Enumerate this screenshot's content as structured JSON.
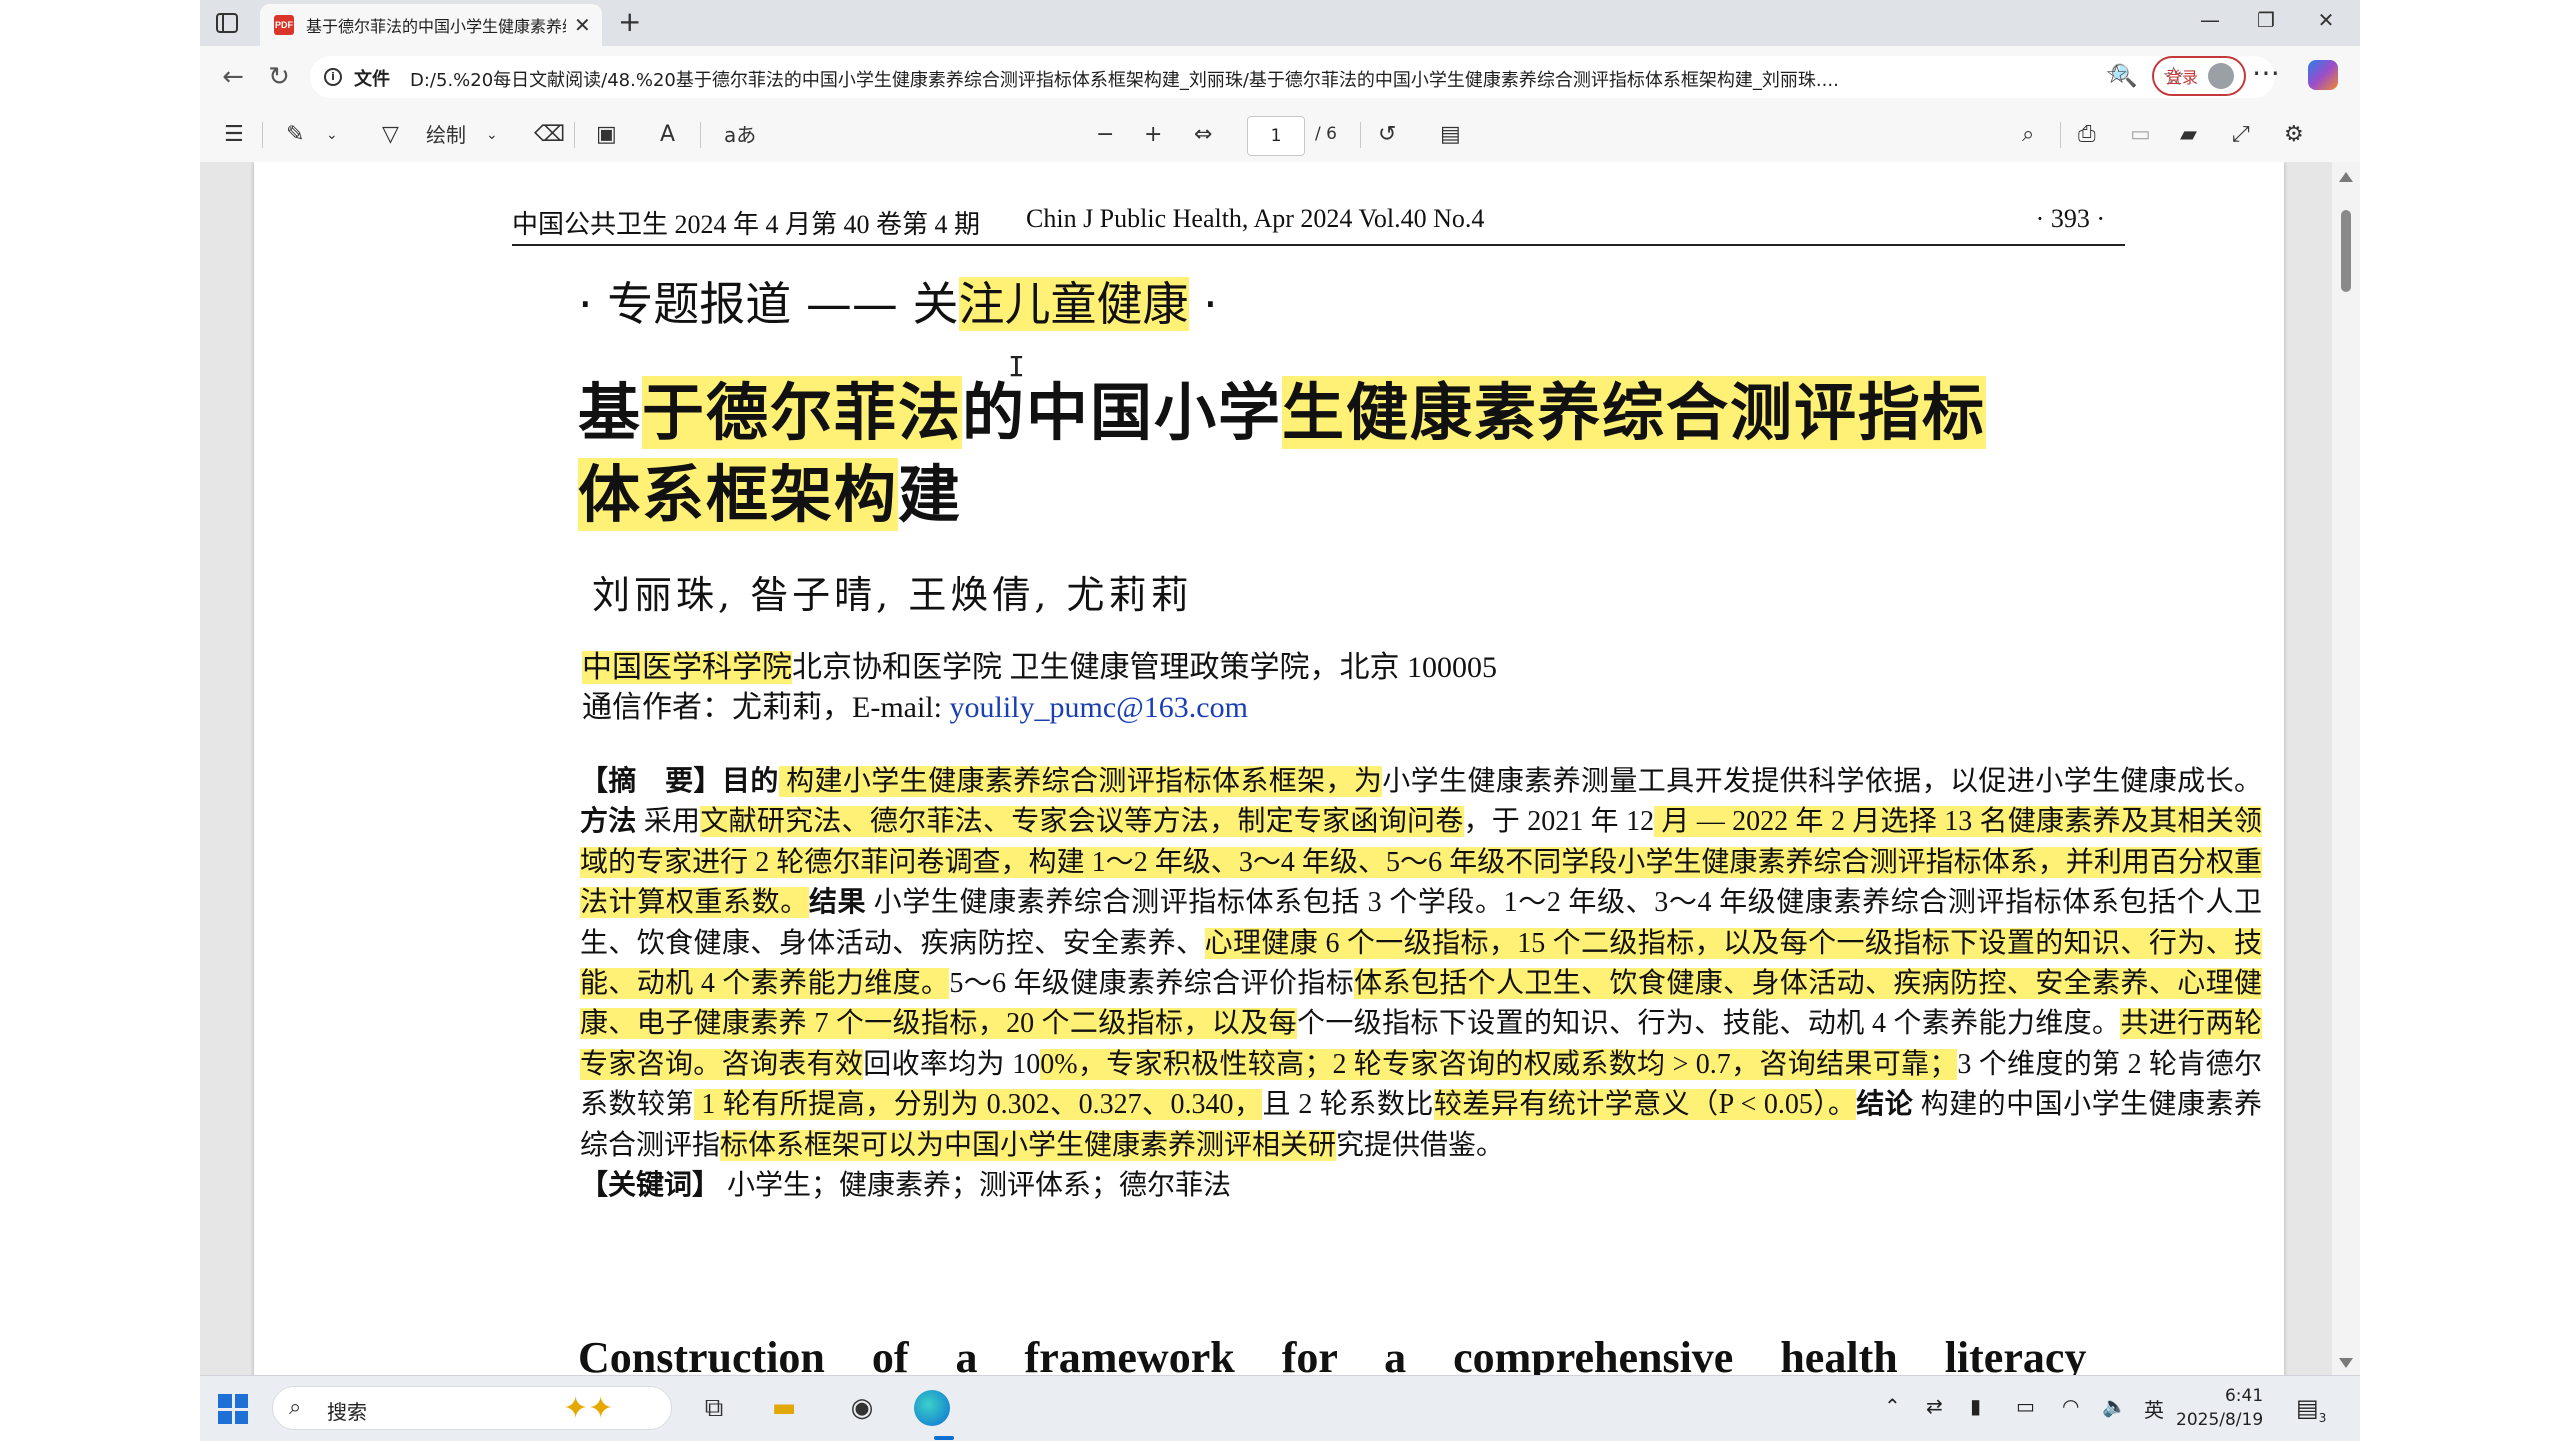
{
  "browser": {
    "tab_title": "基于德尔菲法的中国小学生健康素养综合测评指标体系框架构建_刘丽珠",
    "tab_icon": "pdf-icon",
    "address_label": "文件",
    "url": "D:/5.%20每日文献阅读/48.%20基于德尔菲法的中国小学生健康素养综合测评指标体系框架构建_刘丽珠/基于德尔菲法的中国小学生健康素养综合测评指标体系框架构建_刘丽珠....",
    "login_label": "登录"
  },
  "pdf_toolbar": {
    "draw_label": "绘制",
    "read_aloud_label": "aあ",
    "page_current": "1",
    "page_total": "/ 6"
  },
  "page": {
    "running_head_cn": "中国公共卫生 2024 年 4 月第 40 卷第 4 期",
    "running_head_en": "Chin J Public Health, Apr  2024   Vol.40  No.4",
    "page_number": "· 393 ·",
    "topic_prefix": "· 专题报道 —— 关",
    "topic_highlight": "注儿童健康",
    "topic_suffix": " ·",
    "title_1": "基",
    "title_2": "于德尔菲法",
    "title_3": "的中国小学",
    "title_4": "生健康素养综合测评指标",
    "title_5": "体系框架构",
    "title_6": "建",
    "authors": "刘丽珠, 昝子晴, 王焕倩, 尤莉莉",
    "affil_hl": "中国医学科学院",
    "affil_rest": "北京协和医学院 卫生健康管理政策学院，北京 100005",
    "corr_label": "通信作者：尤莉莉，E-mail: ",
    "corr_email": "youlily_pumc@163.com",
    "abs": {
      "label": "【摘　要】",
      "objective_label": "目的",
      "t1": " 构建小学生健康素养综合测评指标体系框架，为",
      "t2": "小学生健康素养测量工具开发提供科学依据，以促进小学生健康成长。",
      "method_label": "方法",
      "t3": " 采用",
      "t4": "文献研究法、德尔菲法、专家会议等方法，制定专家函询问卷",
      "t5": "，于 2021 年 12",
      "t6": " 月 — 2022 年 2 月选择 13 名健康素养及其相关领域的专家进行 2 轮德尔菲问卷调查，构建 1～2 年级、3～4 年级、5～6 年级不同学段小学生健康素养综合测评指标体系，并利用百分权重法计算权重系数。",
      "result_label": "结果",
      "t7": " 小学生健康素养综合测评指标体系包括 3 个学段。1～2 年级、3～4 年级健康素养综合测评指标体系包括个人卫生、饮食健康、身体活动、疾病防控、安全素养、",
      "t8": "心理健康 6 个一级指标，15 个二级指标，以及每个一级指标下设置的知识、行为、技能、动机 4 个素养能力维度。",
      "t9": "5～6 年级健康素养综合评价指标",
      "t10": "体系包括个人卫生、饮食健康、身体活动、疾病防控、安全素养、心理健康、电子健康素养 7 个一级指标，20 个二级指标，以及每",
      "t11": "个一级指标下设置的知识、行为、技能、动机 4 个素养能力维度。",
      "t12": "共进行两轮专家咨询。咨询表有效",
      "t13": "回收率均为 10",
      "t14": "0%，专家积极性较高；2 轮专家咨询的权威系数均 > 0.7，咨询结果可靠；",
      "t15": "3 个维度的第 2 轮肯德尔系数较第",
      "t16": " 1 轮有所提高，分别为 0.302、0.327、0.340，",
      "t17": "且 2 轮系数比",
      "t18": "较差异有统计学意义（P < 0.05）。",
      "conclusion_label": "结论",
      "t19": " 构建的中国小学生健康素养综合测评指",
      "t20": "标体系框架可以为中国小学生健康素养测评相关研",
      "t21": "究提供借鉴。"
    },
    "keywords_label": "【关键词】",
    "keywords": " 小学生；健康素养；测评体系；德尔菲法",
    "en_title": "Construction of a framework for a comprehensive health literacy"
  },
  "taskbar": {
    "search_label": "搜索",
    "ime_label": "英",
    "time": "6:41",
    "date": "2025/8/19",
    "notification_count": "3"
  },
  "colors": {
    "highlight": "#fff176",
    "email_link": "#1a3fb5",
    "login_accent": "#c43a3a"
  }
}
